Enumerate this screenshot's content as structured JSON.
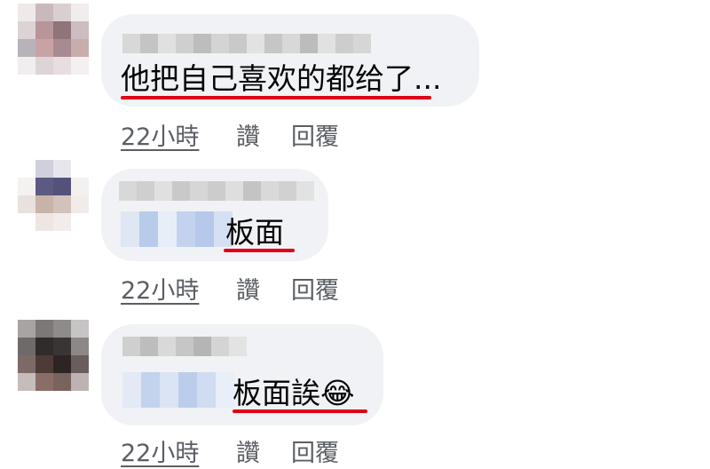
{
  "comments": [
    {
      "text": "他把自己喜欢的都给了...",
      "time": "22小時",
      "like": "讚",
      "reply": "回覆"
    },
    {
      "text": "板面",
      "time": "22小時",
      "like": "讚",
      "reply": "回覆"
    },
    {
      "text": "板面誒😂",
      "time": "22小時",
      "like": "讚",
      "reply": "回覆"
    }
  ],
  "colors": {
    "bubble": "#f0f2f5",
    "underline": "#e0001a",
    "action_text": "#5b5f64"
  }
}
